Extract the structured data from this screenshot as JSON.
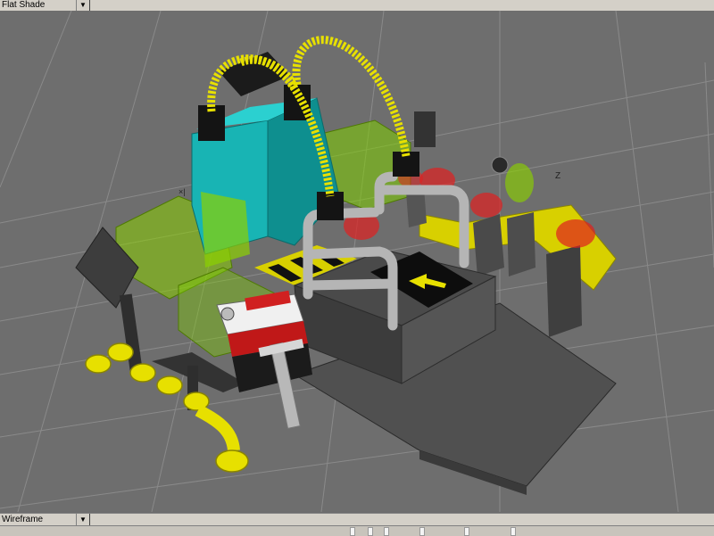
{
  "top_view": {
    "shading_mode": "Flat Shade"
  },
  "bottom_view": {
    "shading_mode": "Wireframe"
  },
  "axis_labels": {
    "z": "Z"
  },
  "colors": {
    "viewport_bg": "#6e6e6e",
    "grid": "#8a8a8a",
    "hose_yellow": "#e7e000",
    "teal_box": "#18b4b4",
    "green_transparent": "#7fd000",
    "red_transparent": "#e02020"
  },
  "icons": [
    "dropdown-arrow-icon",
    "dropdown-arrow-icon"
  ]
}
